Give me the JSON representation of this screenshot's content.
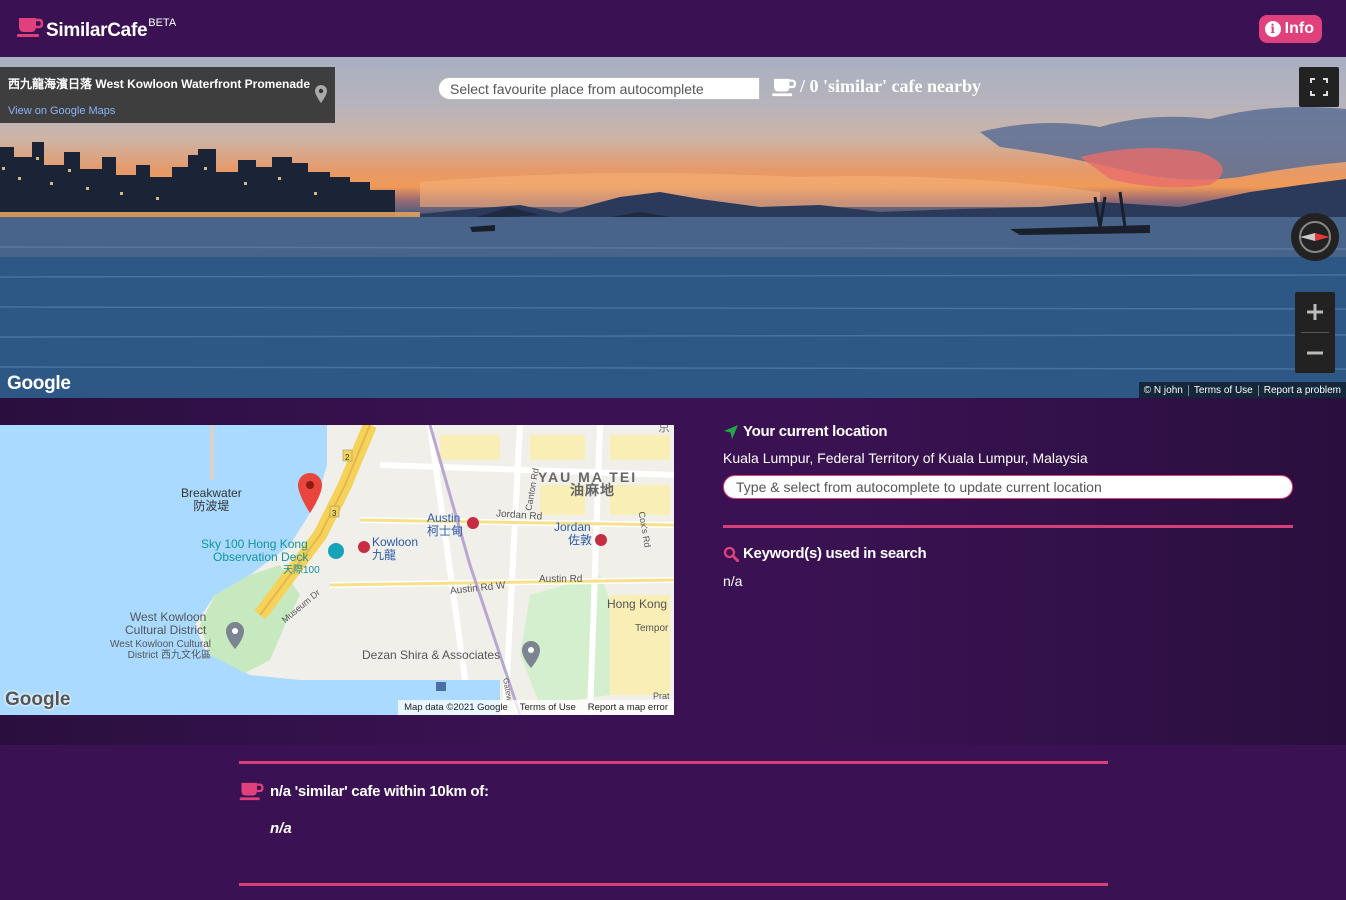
{
  "header": {
    "brand_name": "SimilarCafe",
    "brand_beta": "BETA",
    "info_label": "Info"
  },
  "streetview": {
    "place_name": "西九龍海濱日落 West Kowloon Waterfront Promenade",
    "place_link": "View on Google Maps",
    "search_placeholder": "Select favourite place from autocomplete",
    "nearby_count": "/ 0 'similar' cafe nearby",
    "google_logo": "Google",
    "attribution": [
      "© N john",
      "Terms of Use",
      "Report a problem"
    ]
  },
  "map": {
    "labels": {
      "yau_ma_tei_en": "YAU MA TEI",
      "yau_ma_tei_zh": "油麻地",
      "breakwater_en": "Breakwater",
      "breakwater_zh": "防波堤",
      "sky100_en": "Sky 100 Hong Kong",
      "sky100_en2": "Observation Deck",
      "sky100_zh": "天際100",
      "austin_en": "Austin",
      "austin_zh": "柯士甸",
      "jordan_en": "Jordan",
      "jordan_zh": "佐敦",
      "jordan_rd": "Jordan Rd",
      "kowloon_en": "Kowloon",
      "kowloon_zh": "九龍",
      "austin_rd": "Austin Rd",
      "austin_rd_w": "Austin Rd W",
      "canton_rd": "Canton Rd",
      "coxs_rd": "Cox's Rd",
      "museum_dr": "Museum Dr",
      "hong_kong": "Hong Kong",
      "tempor": "Tempor",
      "wkcd_en": "West Kowloon",
      "wkcd_en2": "Cultural District",
      "wkcd_small": "West Kowloon Cultural",
      "wkcd_small2": "District 西九文化區",
      "dezan": "Dezan Shira & Associates",
      "gateway": "Gatew",
      "prat": "Prat",
      "route2": "2",
      "route3": "3",
      "corner_zh": "京"
    },
    "google_logo": "Google",
    "attribution": [
      "Map data ©2021 Google",
      "Terms of Use",
      "Report a map error"
    ]
  },
  "location": {
    "heading": "Your current location",
    "value": "Kuala Lumpur, Federal Territory of Kuala Lumpur, Malaysia",
    "input_placeholder": "Type & select from autocomplete to update current location"
  },
  "keywords": {
    "heading": "Keyword(s) used in search",
    "value": "n/a"
  },
  "result": {
    "heading": "n/a 'similar' cafe within 10km of:",
    "value": "n/a"
  },
  "colors": {
    "background": "#3a1253",
    "accent": "#e0417d",
    "rule": "#d63f77",
    "location_icon": "#1fa84a"
  }
}
